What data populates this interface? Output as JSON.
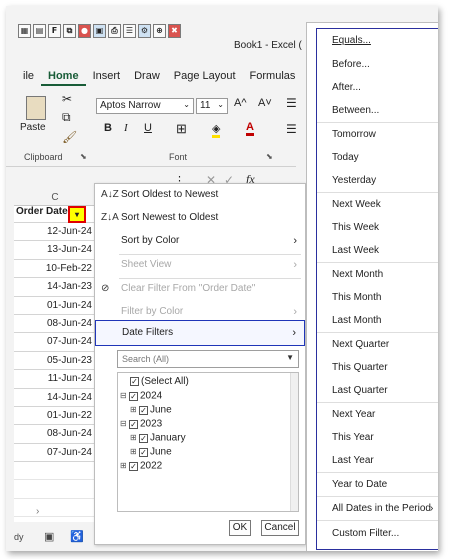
{
  "window": {
    "title": "Book1 - Excel ("
  },
  "ribbon": {
    "tabs": [
      "ile",
      "Home",
      "Insert",
      "Draw",
      "Page Layout",
      "Formulas"
    ],
    "paste_label": "Paste",
    "clipboard_label": "Clipboard",
    "font_label": "Font",
    "font_name": "Aptos Narrow",
    "font_size": "11",
    "grow_label": "A^",
    "shrink_label": "A˅",
    "bold": "B",
    "italic": "I",
    "underline": "U",
    "font_color_glyph": "A"
  },
  "formula_bar": {
    "fx": "fx"
  },
  "sheet": {
    "column": "C",
    "header": "Order Date",
    "rows": [
      "12-Jun-24",
      "13-Jun-24",
      "10-Feb-22",
      "14-Jan-23",
      "01-Jun-24",
      "08-Jun-24",
      "07-Jun-24",
      "05-Jun-23",
      "11-Jun-24",
      "14-Jun-24",
      "01-Jun-22",
      "08-Jun-24",
      "07-Jun-24"
    ]
  },
  "status": {
    "ready": "dy"
  },
  "filter_menu": {
    "sort_asc": "Sort Oldest to Newest",
    "sort_desc": "Sort Newest to Oldest",
    "sort_color": "Sort by Color",
    "sheet_view": "Sheet View",
    "clear_filter": "Clear Filter From \"Order Date\"",
    "filter_color": "Filter by Color",
    "date_filters": "Date Filters",
    "search_placeholder": "Search (All)",
    "tree": {
      "select_all": "(Select All)",
      "y2024": "2024",
      "june1": "June",
      "y2023": "2023",
      "january": "January",
      "june2": "June",
      "y2022": "2022"
    },
    "ok": "OK",
    "cancel": "Cancel"
  },
  "date_submenu": {
    "items": [
      "Equals...",
      "Before...",
      "After...",
      "Between...",
      "Tomorrow",
      "Today",
      "Yesterday",
      "Next Week",
      "This Week",
      "Last Week",
      "Next Month",
      "This Month",
      "Last Month",
      "Next Quarter",
      "This Quarter",
      "Last Quarter",
      "Next Year",
      "This Year",
      "Last Year",
      "Year to Date",
      "All Dates in the Period",
      "Custom Filter..."
    ]
  },
  "colors": {
    "accent": "#185c37",
    "highlight_border": "#1f35b8",
    "filter_button_fill": "#ffff00",
    "filter_button_border": "#e00000"
  }
}
